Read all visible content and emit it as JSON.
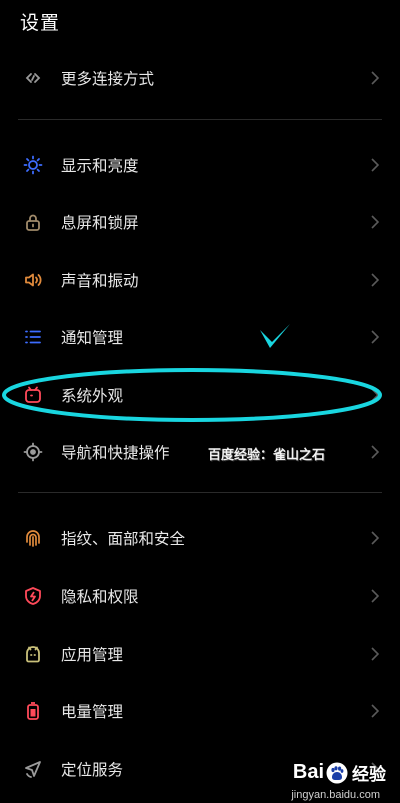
{
  "header": {
    "title": "设置"
  },
  "groups": [
    {
      "items": [
        {
          "label": "更多连接方式",
          "icon": "link-icon",
          "color": "#9a9a9a"
        }
      ]
    },
    {
      "items": [
        {
          "label": "显示和亮度",
          "icon": "sun-icon",
          "color": "#3d6cff"
        },
        {
          "label": "息屏和锁屏",
          "icon": "lock-icon",
          "color": "#a08a6a"
        },
        {
          "label": "声音和振动",
          "icon": "speaker-icon",
          "color": "#e08a3c"
        },
        {
          "label": "通知管理",
          "icon": "list-icon",
          "color": "#3d6cff"
        },
        {
          "label": "系统外观",
          "icon": "theme-icon",
          "color": "#ff4a5a"
        },
        {
          "label": "导航和快捷操作",
          "icon": "target-icon",
          "color": "#9a9a9a"
        }
      ]
    },
    {
      "items": [
        {
          "label": "指纹、面部和安全",
          "icon": "fingerprint-icon",
          "color": "#e08a3c"
        },
        {
          "label": "隐私和权限",
          "icon": "shield-icon",
          "color": "#ff4a5a"
        },
        {
          "label": "应用管理",
          "icon": "app-icon",
          "color": "#c9c07a"
        },
        {
          "label": "电量管理",
          "icon": "battery-icon",
          "color": "#ff4a5a"
        },
        {
          "label": "定位服务",
          "icon": "location-icon",
          "color": "#9a9a9a"
        }
      ]
    }
  ],
  "annotation": {
    "highlight_color": "#19d6e0",
    "watermark_text": "百度经验：雀山之石"
  },
  "branding": {
    "logo_left": "Bai",
    "logo_right": "经验",
    "url": "jingyan.baidu.com"
  }
}
